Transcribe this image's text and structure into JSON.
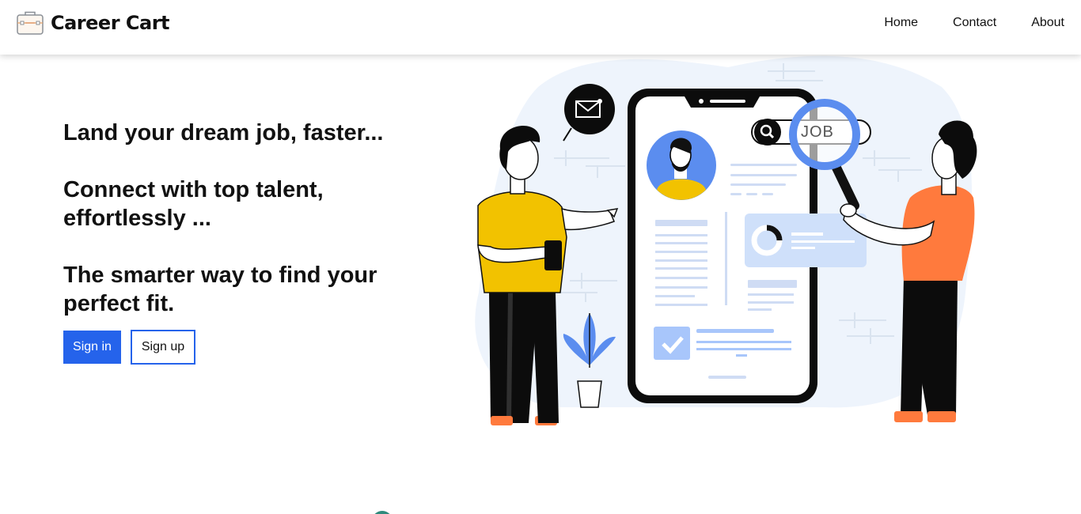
{
  "header": {
    "brand": "Career Cart",
    "logo_icon": "briefcase-icon",
    "nav": [
      {
        "label": "Home"
      },
      {
        "label": "Contact"
      },
      {
        "label": "About"
      }
    ]
  },
  "hero": {
    "headlines": [
      "Land your dream job, faster...",
      "Connect with top talent, effortlessly ...",
      "The smarter way to find your perfect fit."
    ],
    "signin_label": "Sign in",
    "signup_label": "Sign up",
    "illustration": {
      "search_tag": "JOB",
      "icons": [
        "envelope-icon",
        "magnifier-icon",
        "check-icon",
        "avatar-icon",
        "plant-icon"
      ]
    }
  },
  "colors": {
    "primary": "#2563eb",
    "accent_orange": "#ff7a3d",
    "accent_yellow": "#f2c200",
    "blob": "#eef4fc",
    "ui_blue": "#5b8def"
  }
}
